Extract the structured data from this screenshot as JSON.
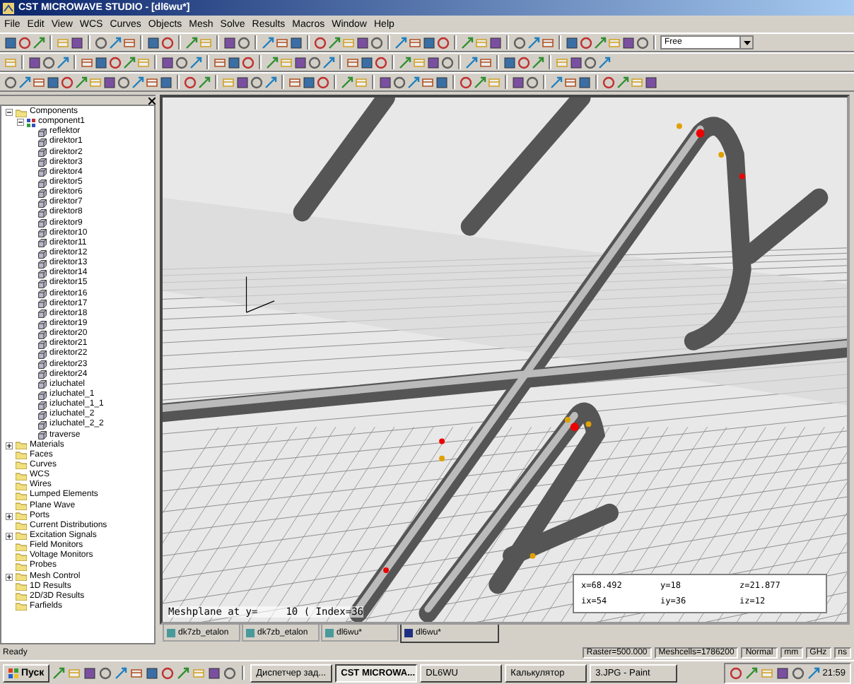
{
  "window": {
    "title": "CST MICROWAVE STUDIO - [dl6wu*]"
  },
  "menu": [
    "File",
    "Edit",
    "View",
    "WCS",
    "Curves",
    "Objects",
    "Mesh",
    "Solve",
    "Results",
    "Macros",
    "Window",
    "Help"
  ],
  "view_mode": {
    "value": "Free"
  },
  "tree": [
    {
      "label": "Components",
      "kind": "folder",
      "expanded": true,
      "children": [
        {
          "label": "component1",
          "kind": "group",
          "expanded": true,
          "children": [
            {
              "label": "reflektor",
              "kind": "solid"
            },
            {
              "label": "direktor1",
              "kind": "solid"
            },
            {
              "label": "direktor2",
              "kind": "solid"
            },
            {
              "label": "direktor3",
              "kind": "solid"
            },
            {
              "label": "direktor4",
              "kind": "solid"
            },
            {
              "label": "direktor5",
              "kind": "solid"
            },
            {
              "label": "direktor6",
              "kind": "solid"
            },
            {
              "label": "direktor7",
              "kind": "solid"
            },
            {
              "label": "direktor8",
              "kind": "solid"
            },
            {
              "label": "direktor9",
              "kind": "solid"
            },
            {
              "label": "direktor10",
              "kind": "solid"
            },
            {
              "label": "direktor11",
              "kind": "solid"
            },
            {
              "label": "direktor12",
              "kind": "solid"
            },
            {
              "label": "direktor13",
              "kind": "solid"
            },
            {
              "label": "direktor14",
              "kind": "solid"
            },
            {
              "label": "direktor15",
              "kind": "solid"
            },
            {
              "label": "direktor16",
              "kind": "solid"
            },
            {
              "label": "direktor17",
              "kind": "solid"
            },
            {
              "label": "direktor18",
              "kind": "solid"
            },
            {
              "label": "direktor19",
              "kind": "solid"
            },
            {
              "label": "direktor20",
              "kind": "solid"
            },
            {
              "label": "direktor21",
              "kind": "solid"
            },
            {
              "label": "direktor22",
              "kind": "solid"
            },
            {
              "label": "direktor23",
              "kind": "solid"
            },
            {
              "label": "direktor24",
              "kind": "solid"
            },
            {
              "label": "izluchatel",
              "kind": "solid"
            },
            {
              "label": "izluchatel_1",
              "kind": "solid"
            },
            {
              "label": "izluchatel_1_1",
              "kind": "solid"
            },
            {
              "label": "izluchatel_2",
              "kind": "solid"
            },
            {
              "label": "izluchatel_2_2",
              "kind": "solid"
            },
            {
              "label": "traverse",
              "kind": "solid"
            }
          ]
        }
      ]
    },
    {
      "label": "Materials",
      "kind": "folder",
      "expanded": false
    },
    {
      "label": "Faces",
      "kind": "folder"
    },
    {
      "label": "Curves",
      "kind": "folder"
    },
    {
      "label": "WCS",
      "kind": "folder"
    },
    {
      "label": "Wires",
      "kind": "folder"
    },
    {
      "label": "Lumped Elements",
      "kind": "folder"
    },
    {
      "label": "Plane Wave",
      "kind": "folder"
    },
    {
      "label": "Ports",
      "kind": "folder",
      "expanded": false
    },
    {
      "label": "Current Distributions",
      "kind": "folder"
    },
    {
      "label": "Excitation Signals",
      "kind": "folder",
      "expanded": false
    },
    {
      "label": "Field Monitors",
      "kind": "folder"
    },
    {
      "label": "Voltage Monitors",
      "kind": "folder"
    },
    {
      "label": "Probes",
      "kind": "folder"
    },
    {
      "label": "Mesh Control",
      "kind": "folder",
      "expanded": false
    },
    {
      "label": "1D Results",
      "kind": "folder"
    },
    {
      "label": "2D/3D Results",
      "kind": "folder"
    },
    {
      "label": "Farfields",
      "kind": "folder"
    }
  ],
  "viewport": {
    "meshplane_label": "Meshplane at y=",
    "meshplane_value": "10 ( Index=36",
    "coordinates": [
      "x=68.492",
      "y=18",
      "z=21.877",
      "ix=54",
      "iy=36",
      "iz=12"
    ]
  },
  "doc_tabs": [
    {
      "label": "dk7zb_etalon",
      "selected": false
    },
    {
      "label": "dk7zb_etalon",
      "selected": false
    },
    {
      "label": "dl6wu*",
      "selected": false
    },
    {
      "label": "dl6wu*",
      "selected": true
    }
  ],
  "status_bar": {
    "message": "Ready",
    "fields": [
      "Raster=500.000",
      "Meshcells=1786200",
      "Normal",
      "mm",
      "GHz",
      "ns"
    ]
  },
  "taskbar": {
    "start": "Пуск",
    "tasks": [
      {
        "label": "Диспетчер зад...",
        "selected": false
      },
      {
        "label": "CST MICROWA...",
        "selected": true
      },
      {
        "label": "DL6WU",
        "selected": false
      },
      {
        "label": "Калькулятор",
        "selected": false
      },
      {
        "label": "3.JPG - Paint",
        "selected": false
      }
    ],
    "clock": "21:59"
  }
}
